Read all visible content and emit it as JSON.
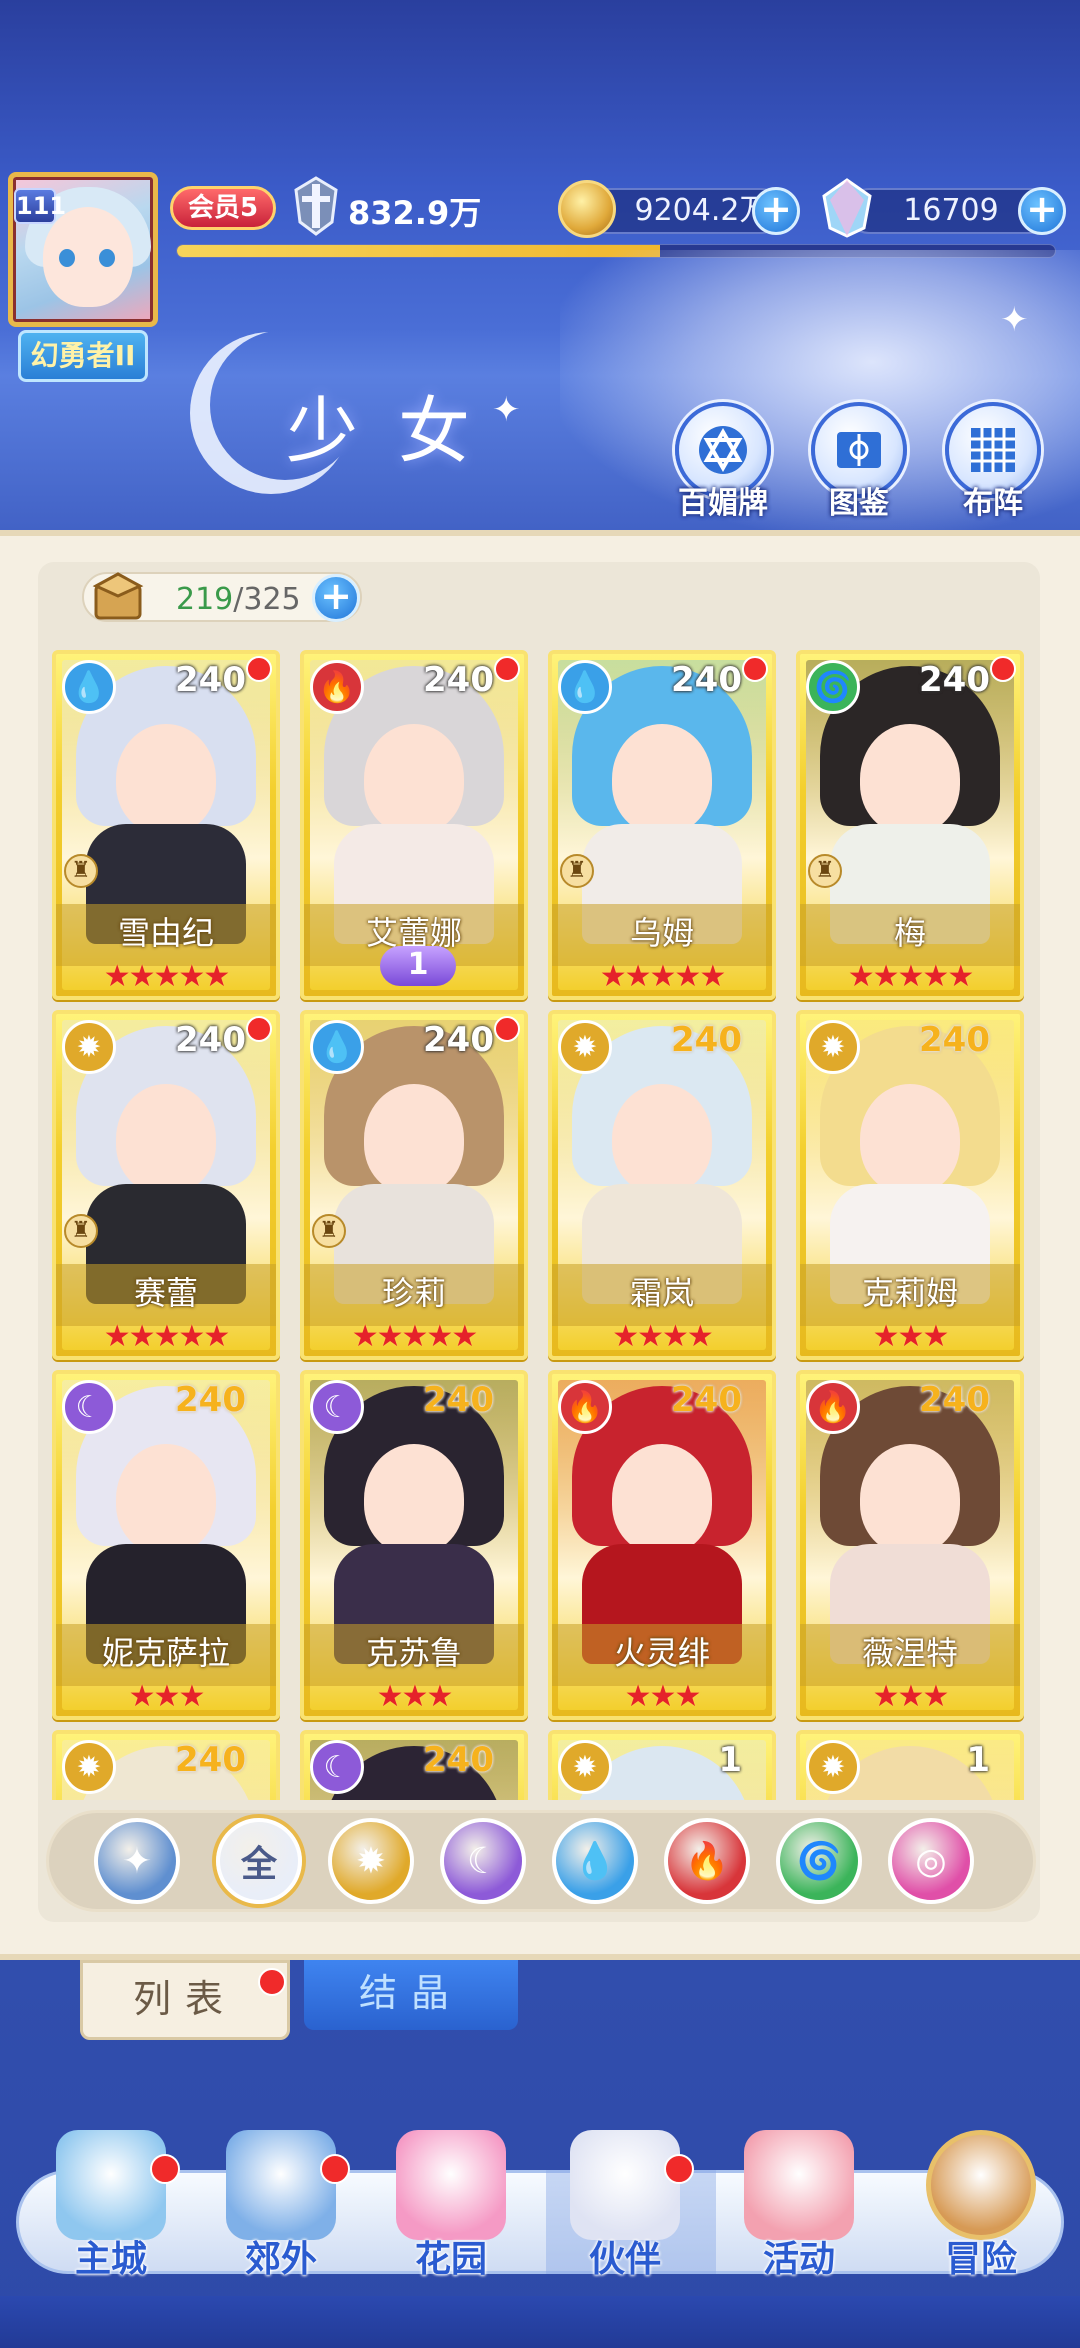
{
  "player": {
    "level": "111",
    "title": "幻勇者II",
    "vip": "会员5",
    "power": "832.9万",
    "gold": "9204.2万",
    "crystal": "16709",
    "exp_fraction": 0.55
  },
  "header": {
    "title": "少女",
    "buttons": [
      {
        "label": "百媚牌",
        "icon": "card-collection-icon"
      },
      {
        "label": "图鉴",
        "icon": "book-icon"
      },
      {
        "label": "布阵",
        "icon": "grid-formation-icon"
      }
    ]
  },
  "collection": {
    "current": "219",
    "separator": "/",
    "max": "325"
  },
  "cards": [
    {
      "name": "雪由纪",
      "level": "240",
      "stars": "★★★★★",
      "element": "water",
      "red_dot": true,
      "gold_level": false,
      "rank_icon": true,
      "hair": "#d8dff0",
      "body": "#2c2c38",
      "awaken": ""
    },
    {
      "name": "艾蕾娜",
      "level": "240",
      "stars": "",
      "element": "fire",
      "red_dot": true,
      "gold_level": false,
      "rank_icon": false,
      "hair": "#d9d6d8",
      "body": "#f4eae6",
      "awaken": "1"
    },
    {
      "name": "乌姆",
      "level": "240",
      "stars": "★★★★★",
      "element": "water",
      "red_dot": true,
      "gold_level": false,
      "rank_icon": true,
      "hair": "#5ab7ec",
      "body": "#f1ece8",
      "awaken": ""
    },
    {
      "name": "梅",
      "level": "240",
      "stars": "★★★★★",
      "element": "wind",
      "red_dot": true,
      "gold_level": false,
      "rank_icon": true,
      "hair": "#2b2626",
      "body": "#eef0ea",
      "awaken": ""
    },
    {
      "name": "赛蕾",
      "level": "240",
      "stars": "★★★★★",
      "element": "light",
      "red_dot": true,
      "gold_level": false,
      "rank_icon": true,
      "hair": "#dfe3ef",
      "body": "#2a2a30",
      "awaken": ""
    },
    {
      "name": "珍莉",
      "level": "240",
      "stars": "★★★★★",
      "element": "water",
      "red_dot": true,
      "gold_level": false,
      "rank_icon": true,
      "hair": "#b9936a",
      "body": "#e8e2dc",
      "awaken": ""
    },
    {
      "name": "霜岚",
      "level": "240",
      "stars": "★★★★",
      "element": "light",
      "red_dot": false,
      "gold_level": true,
      "rank_icon": false,
      "hair": "#dbe8f2",
      "body": "#efe6d8",
      "awaken": ""
    },
    {
      "name": "克莉姆",
      "level": "240",
      "stars": "★★★",
      "element": "light",
      "red_dot": false,
      "gold_level": true,
      "rank_icon": false,
      "hair": "#f3dc8e",
      "body": "#f6f2f0",
      "awaken": ""
    },
    {
      "name": "妮克萨拉",
      "level": "240",
      "stars": "★★★",
      "element": "dark",
      "red_dot": false,
      "gold_level": true,
      "rank_icon": false,
      "hair": "#e7e6f2",
      "body": "#25222c",
      "awaken": ""
    },
    {
      "name": "克苏鲁",
      "level": "240",
      "stars": "★★★",
      "element": "dark",
      "red_dot": false,
      "gold_level": true,
      "rank_icon": false,
      "hair": "#2a2430",
      "body": "#3a2e4a",
      "awaken": ""
    },
    {
      "name": "火灵绯",
      "level": "240",
      "stars": "★★★",
      "element": "fire",
      "red_dot": false,
      "gold_level": true,
      "rank_icon": false,
      "hair": "#c8232e",
      "body": "#b5161e",
      "awaken": ""
    },
    {
      "name": "薇涅特",
      "level": "240",
      "stars": "★★★",
      "element": "fire",
      "red_dot": false,
      "gold_level": true,
      "rank_icon": false,
      "hair": "#6e4a36",
      "body": "#f0ddd6",
      "awaken": ""
    },
    {
      "name": "",
      "level": "240",
      "stars": "",
      "element": "light",
      "red_dot": false,
      "gold_level": true,
      "rank_icon": false,
      "hair": "#efe7d2",
      "body": "#efe7d2",
      "awaken": ""
    },
    {
      "name": "",
      "level": "240",
      "stars": "",
      "element": "dark",
      "red_dot": false,
      "gold_level": true,
      "rank_icon": false,
      "hair": "#2c2434",
      "body": "#2c2434",
      "awaken": ""
    },
    {
      "name": "",
      "level": "1",
      "stars": "",
      "element": "light",
      "red_dot": false,
      "gold_level": false,
      "rank_icon": false,
      "hair": "#dbe7f1",
      "body": "#dbe7f1",
      "awaken": ""
    },
    {
      "name": "",
      "level": "1",
      "stars": "",
      "element": "light",
      "red_dot": false,
      "gold_level": false,
      "rank_icon": false,
      "hair": "#f2dca6",
      "body": "#f2dca6",
      "awaken": ""
    }
  ],
  "element_colors": {
    "water": "#3aa0e8",
    "fire": "#d8353a",
    "wind": "#3bb45a",
    "light": "#e0a92a",
    "dark": "#8d5ad8"
  },
  "element_glyphs": {
    "water": "💧",
    "fire": "🔥",
    "wind": "🌀",
    "light": "✹",
    "dark": "☾"
  },
  "filters": [
    {
      "id": "favorite",
      "label": "",
      "glyph": "✦",
      "color": "#5f8fd0"
    },
    {
      "id": "all",
      "label": "全",
      "glyph": "全",
      "color": "#e9eef8"
    },
    {
      "id": "light",
      "label": "",
      "glyph": "✹",
      "color": "#e0a92a"
    },
    {
      "id": "dark",
      "label": "",
      "glyph": "☾",
      "color": "#8d5ad8"
    },
    {
      "id": "water",
      "label": "",
      "glyph": "💧",
      "color": "#3aa0e8"
    },
    {
      "id": "fire",
      "label": "",
      "glyph": "🔥",
      "color": "#d8353a"
    },
    {
      "id": "wind",
      "label": "",
      "glyph": "🌀",
      "color": "#3bb45a"
    },
    {
      "id": "star",
      "label": "",
      "glyph": "◎",
      "color": "#e04fa8"
    }
  ],
  "tabs": {
    "list": "列表",
    "crystal": "结晶"
  },
  "nav": [
    {
      "label": "主城",
      "icon": "castle-icon",
      "red_dot": true,
      "color": "#8fc7ef"
    },
    {
      "label": "郊外",
      "icon": "portal-icon",
      "red_dot": true,
      "color": "#7fb0e8"
    },
    {
      "label": "花园",
      "icon": "heart-icon",
      "red_dot": false,
      "color": "#f59ac5"
    },
    {
      "label": "伙伴",
      "icon": "partner-icon",
      "red_dot": true,
      "color": "#dfe3f3"
    },
    {
      "label": "活动",
      "icon": "gift-icon",
      "red_dot": false,
      "color": "#f3a1b0"
    },
    {
      "label": "冒险",
      "icon": "adventure-icon",
      "red_dot": false,
      "color": "#d79a55"
    }
  ]
}
